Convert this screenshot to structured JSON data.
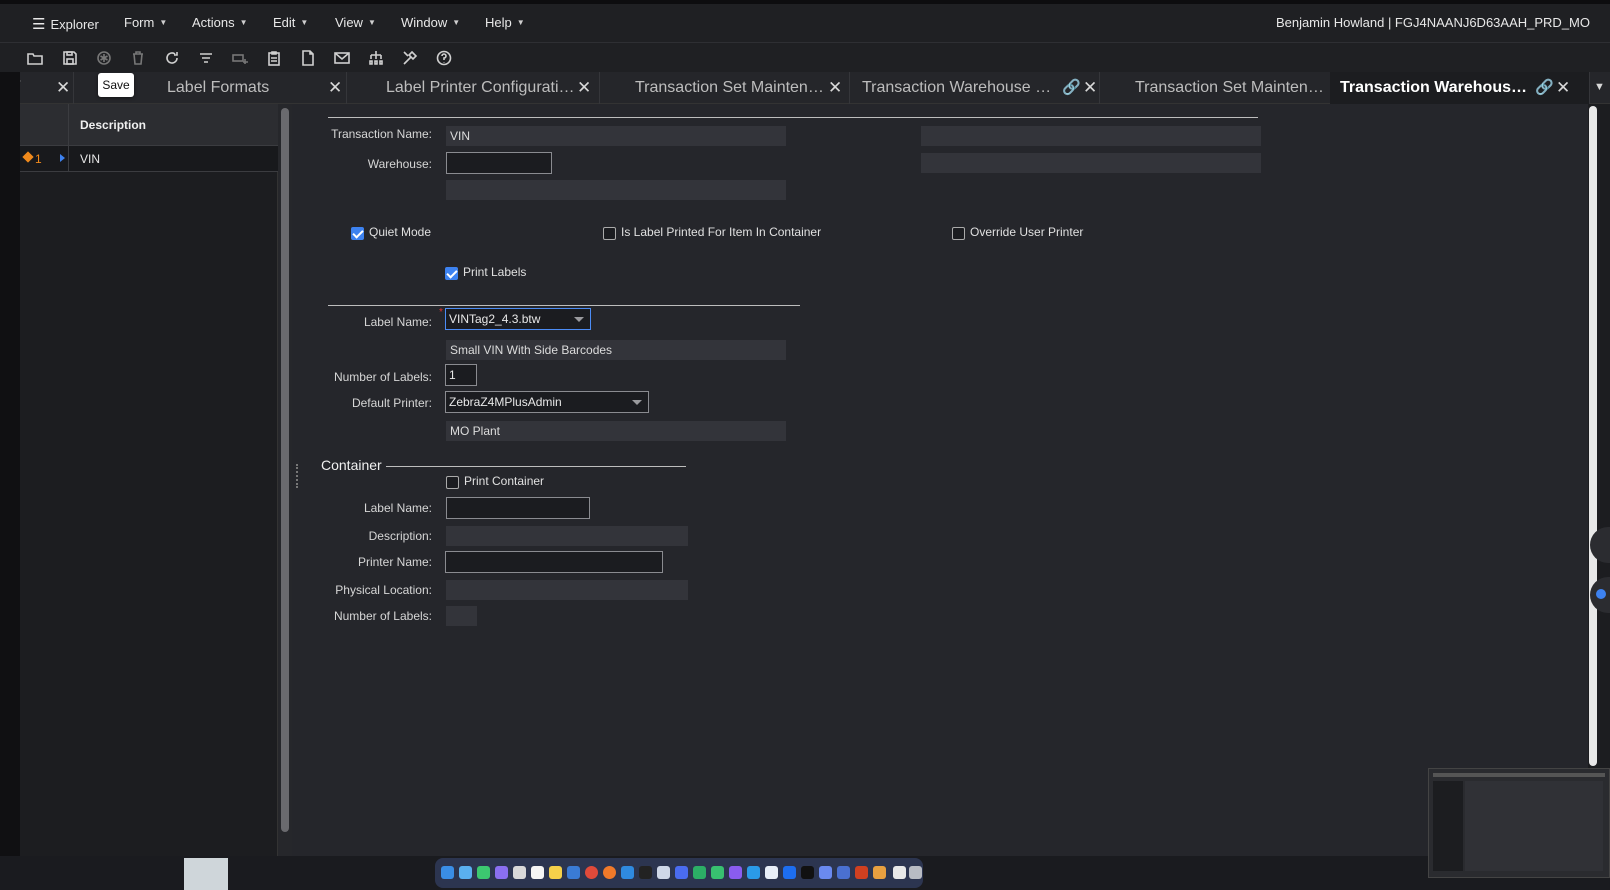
{
  "menubar": {
    "explorer": "Explorer",
    "menus": [
      "Form",
      "Actions",
      "Edit",
      "View",
      "Window",
      "Help"
    ],
    "user_info": "Benjamin Howland | FGJ4NAANJ6D63AAH_PRD_MO"
  },
  "toolbar": {
    "icons": [
      "open-icon",
      "save-icon",
      "asterisk-icon",
      "delete-icon",
      "refresh-icon",
      "filter-icon",
      "add-row-icon",
      "clipboard-icon",
      "document-icon",
      "mail-icon",
      "hierarchy-icon",
      "tools-icon",
      "help-icon"
    ],
    "tooltip": "Save"
  },
  "tabs": [
    {
      "label": "/"
    },
    {
      "label": "Label Formats"
    },
    {
      "label": "Label Printer Configurati…"
    },
    {
      "label": "Transaction Set Mainten…"
    },
    {
      "label": "Transaction Warehouse …"
    },
    {
      "label": "Transaction Set Mainten…"
    },
    {
      "label": "Transaction Warehous…"
    }
  ],
  "grid": {
    "header": "Description",
    "row_num": "1",
    "row_value": "VIN"
  },
  "form": {
    "transaction_name_label": "Transaction Name:",
    "transaction_name_value": "VIN",
    "warehouse_label": "Warehouse:",
    "warehouse_value": "",
    "quiet_mode": "Quiet Mode",
    "is_label_printed": "Is Label Printed For Item In Container",
    "override_user_printer": "Override User Printer",
    "print_labels": "Print Labels",
    "label_name_label": "Label Name:",
    "label_name_value": "VINTag2_4.3.btw",
    "label_description": "Small VIN With Side Barcodes",
    "number_of_labels_label": "Number of Labels:",
    "number_of_labels_value": "1",
    "default_printer_label": "Default Printer:",
    "default_printer_value": "ZebraZ4MPlusAdmin",
    "printer_location": "MO Plant"
  },
  "container": {
    "title": "Container",
    "print_container": "Print Container",
    "label_name_label": "Label Name:",
    "description_label": "Description:",
    "printer_name_label": "Printer Name:",
    "physical_location_label": "Physical Location:",
    "number_of_labels_label": "Number of Labels:"
  },
  "colors": {
    "accent": "#3d82f0",
    "background": "#25262b",
    "required": "#e03030",
    "row_marker": "#f08a1c"
  }
}
